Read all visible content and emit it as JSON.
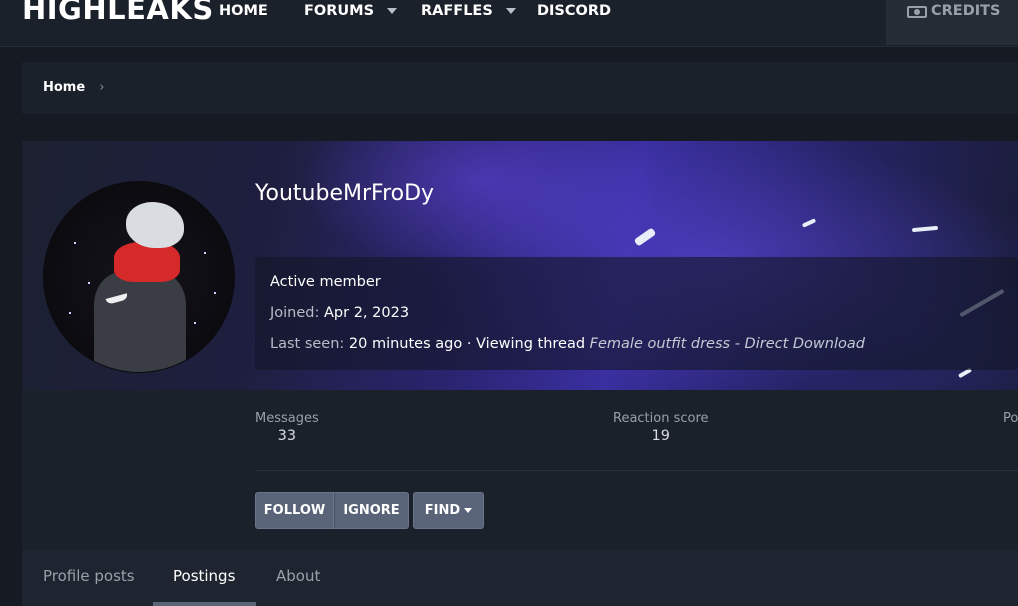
{
  "site": {
    "logo": "HIGHLEAKS",
    "nav": [
      {
        "label": "HOME",
        "has_dropdown": false
      },
      {
        "label": "FORUMS",
        "has_dropdown": true
      },
      {
        "label": "RAFFLES",
        "has_dropdown": true
      },
      {
        "label": "DISCORD",
        "has_dropdown": false
      }
    ],
    "credits_label": "CREDITS",
    "credits_icon": "money-icon"
  },
  "breadcrumb": {
    "items": [
      "Home"
    ],
    "separator": "›"
  },
  "profile": {
    "username": "YoutubeMrFroDy",
    "title": "Active member",
    "joined_label": "Joined:",
    "joined_value": "Apr 2, 2023",
    "last_seen_label": "Last seen:",
    "last_seen_value": "20 minutes ago",
    "activity_text": "· Viewing thread",
    "activity_thread": "Female outfit dress - Direct Download"
  },
  "stats": [
    {
      "label": "Messages",
      "value": "33"
    },
    {
      "label": "Reaction score",
      "value": "19"
    },
    {
      "label": "Po",
      "value": ""
    }
  ],
  "actions": {
    "follow": "FOLLOW",
    "ignore": "IGNORE",
    "find": "FIND"
  },
  "tabs": [
    {
      "label": "Profile posts",
      "active": false
    },
    {
      "label": "Postings",
      "active": true
    },
    {
      "label": "About",
      "active": false
    }
  ],
  "colors": {
    "background": "#151a23",
    "panel": "#1b212b",
    "button": "#5a6478",
    "banner_accent": "#3a2fa0"
  }
}
